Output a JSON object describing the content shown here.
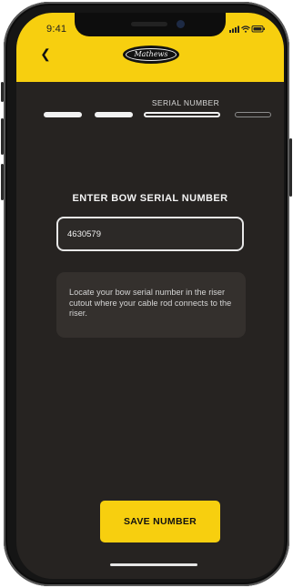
{
  "status_bar": {
    "time": "9:41"
  },
  "header": {
    "logo_text": "Mathews"
  },
  "progress": {
    "current_step_label": "SERIAL NUMBER",
    "steps": [
      "done",
      "done",
      "current",
      "todo"
    ]
  },
  "form": {
    "title": "ENTER BOW SERIAL NUMBER",
    "serial_value": "4630579",
    "help_text": "Locate your bow serial number in the riser cutout where your cable rod connects to the riser."
  },
  "actions": {
    "save_label": "SAVE NUMBER"
  },
  "colors": {
    "accent": "#f7cf0f",
    "background": "#262321",
    "card": "#34302d"
  }
}
